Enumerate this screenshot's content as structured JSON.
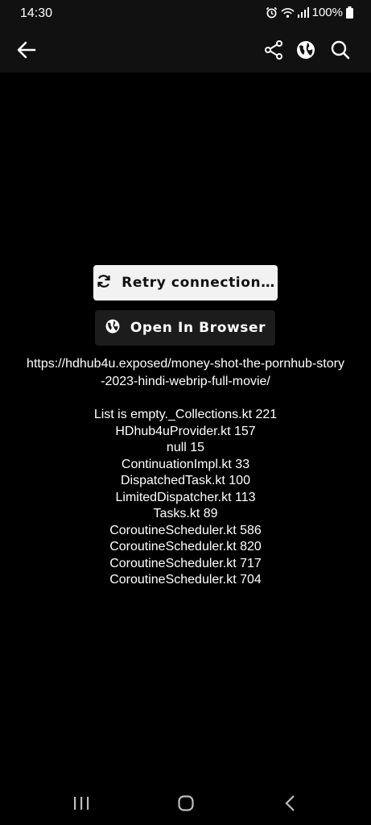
{
  "status_bar": {
    "time": "14:30",
    "battery": "100%",
    "icons": [
      "alarm-icon",
      "wifi-icon",
      "signal-icon",
      "battery-icon"
    ]
  },
  "toolbar": {
    "back_icon": "arrow-left-icon",
    "actions": [
      "share-icon",
      "globe-icon",
      "search-icon"
    ]
  },
  "error_view": {
    "retry_label": "Retry connection…",
    "retry_icon": "refresh-icon",
    "browser_label": "Open In Browser",
    "browser_icon": "globe-icon",
    "url_line1": "https://hdhub4u.exposed/money-shot-the-pornhub-story",
    "url_line2": "-2023-hindi-webrip-full-movie/",
    "stack_trace": [
      "List is empty._Collections.kt 221",
      "HDhub4uProvider.kt 157",
      "null 15",
      "ContinuationImpl.kt 33",
      "DispatchedTask.kt 100",
      "LimitedDispatcher.kt 113",
      "Tasks.kt 89",
      "CoroutineScheduler.kt 586",
      "CoroutineScheduler.kt 820",
      "CoroutineScheduler.kt 717",
      "CoroutineScheduler.kt 704"
    ]
  },
  "nav_bar": {
    "buttons": [
      "recents-icon",
      "home-icon",
      "back-icon"
    ]
  },
  "colors": {
    "background": "#000000",
    "toolbar": "#111111",
    "retry_button": "#f2f2f2",
    "browser_button": "#1c1c1c",
    "text": "#ffffff"
  }
}
